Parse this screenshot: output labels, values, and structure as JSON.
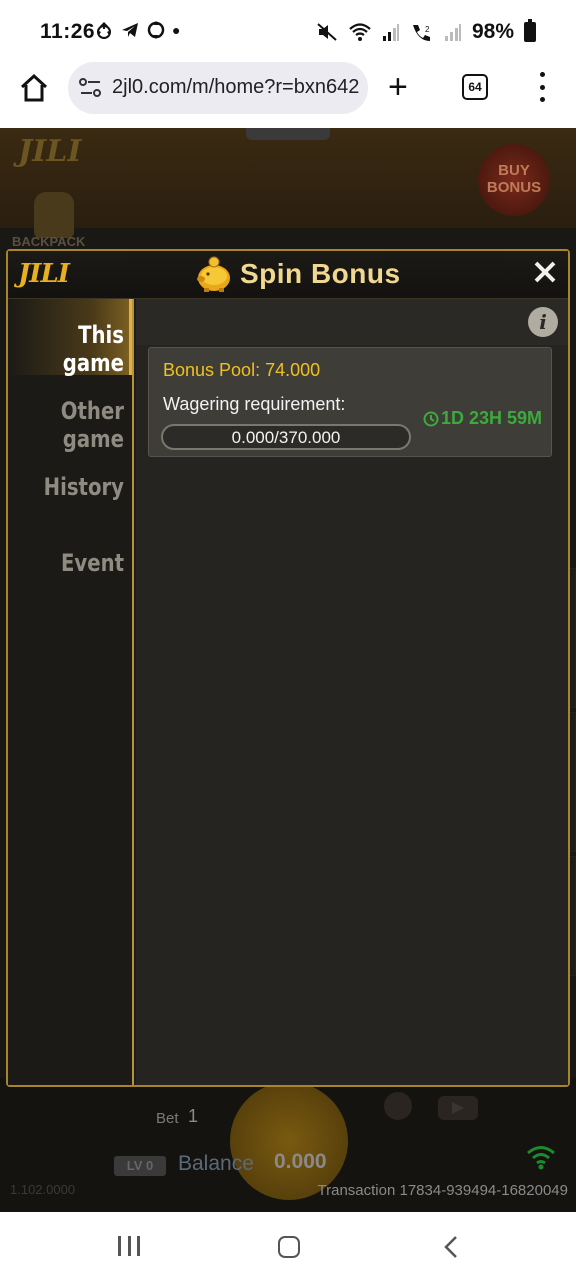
{
  "status": {
    "time": "11:26",
    "left_icons": [
      "sync-icon",
      "telegram-icon",
      "sync-icon",
      "dot-icon"
    ],
    "right_icons": [
      "mute-icon",
      "wifi-icon",
      "signal-icon",
      "wifi-call-icon",
      "signal-icon"
    ],
    "battery": "98%"
  },
  "browser": {
    "url": "2jl0.com/m/home?r=bxn642",
    "tabs_count": "64"
  },
  "game": {
    "logo": "JILI",
    "buy_bonus": "BUY BONUS",
    "backpack_label": "BACKPACK",
    "bet_label": "Bet",
    "bet_value": "1",
    "level": "LV 0",
    "balance_label": "Balance",
    "balance_value": "0.000",
    "transaction": "Transaction 17834-939494-16820049",
    "version": "1.102.0000"
  },
  "modal": {
    "logo": "JILI",
    "title": "Spin Bonus",
    "tabs": [
      {
        "label": "This game",
        "active": true
      },
      {
        "label": "Other game",
        "active": false
      },
      {
        "label": "History",
        "active": false
      },
      {
        "label": "Event",
        "active": false
      }
    ],
    "info_symbol": "i",
    "card": {
      "bonus_pool": "Bonus Pool: 74.000",
      "wagering_label": "Wagering requirement:",
      "wagering_progress": "0.000/370.000",
      "wagering_fraction": 0,
      "timer": "1D 23H 59M"
    }
  },
  "colors": {
    "accent_gold": "#e8b020",
    "timer_green": "#3caa3c",
    "pool_yellow": "#f0c020"
  }
}
